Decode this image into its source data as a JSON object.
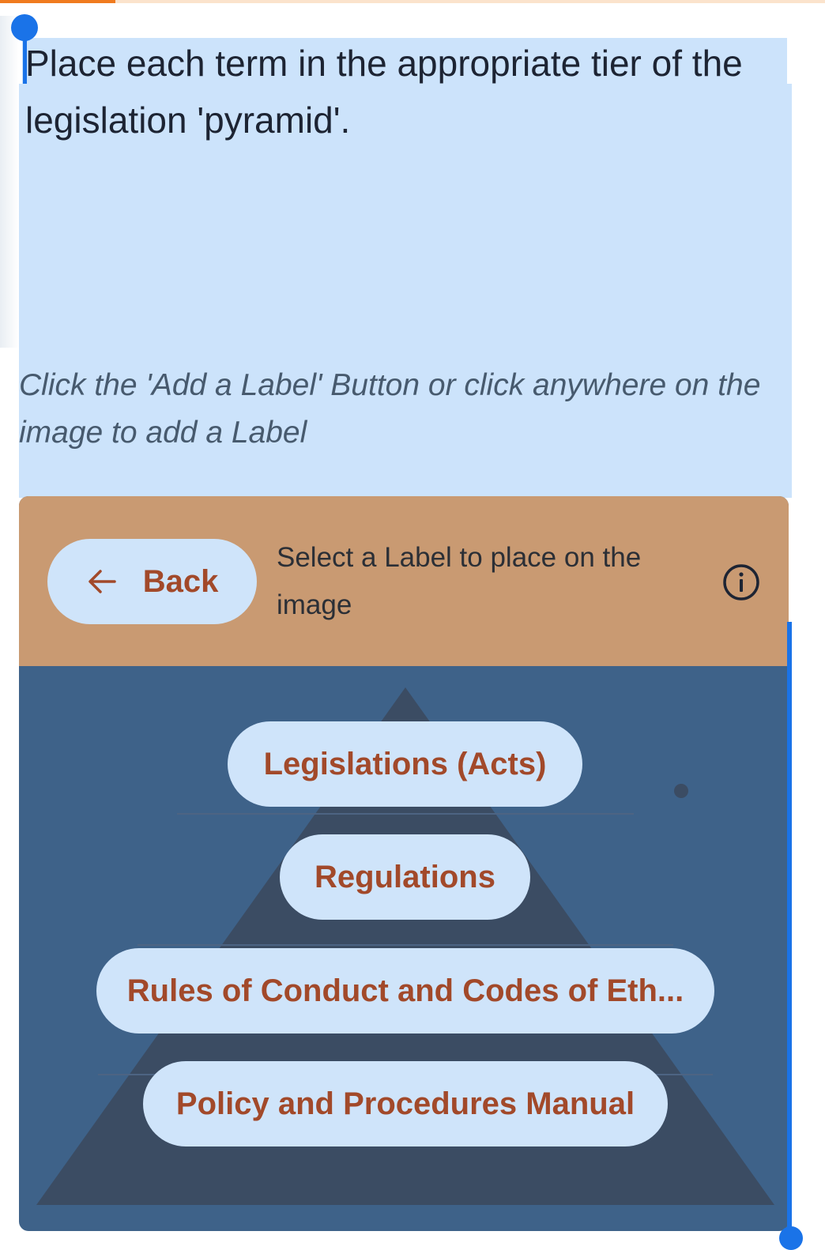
{
  "progress": {
    "fraction": 0.14,
    "color": "#f07b1f"
  },
  "question": {
    "text": "Place each term in the appropriate tier of the legislation 'pyramid'."
  },
  "instruction": {
    "text": "Click the 'Add a Label' Button or click anywhere on the image to add a Label"
  },
  "header": {
    "back_label": "Back",
    "back_icon": "arrow-left-icon",
    "hint": "Select a Label to place on the image",
    "info_icon": "info-icon"
  },
  "labels": [
    {
      "text": "Legislations (Acts)"
    },
    {
      "text": "Regulations"
    },
    {
      "text": "Rules of Conduct and Codes of Eth..."
    },
    {
      "text": "Policy and Procedures Manual"
    }
  ],
  "colors": {
    "selection_highlight": "#cce3fb",
    "header_bg": "#c99a72",
    "image_bg": "#3e6289",
    "pyramid": "#3b4c63",
    "chip_bg": "#cfe4fa",
    "chip_text": "#a2492a",
    "accent": "#1a73e8"
  }
}
